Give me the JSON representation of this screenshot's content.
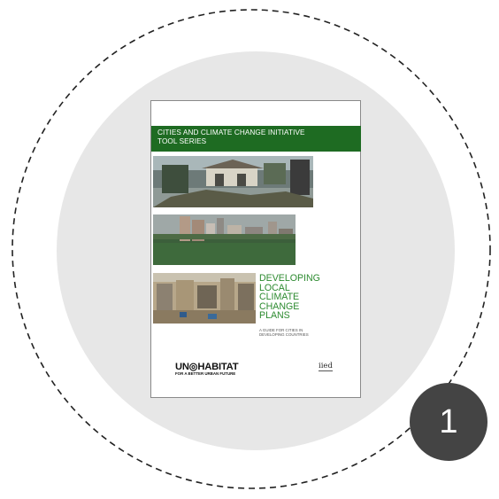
{
  "cover": {
    "series_line1": "CITIES AND CLIMATE CHANGE INITIATIVE",
    "series_line2": "TOOL SERIES",
    "title_line1": "DEVELOPING",
    "title_line2": "LOCAL",
    "title_line3": "CLIMATE",
    "title_line4": "CHANGE",
    "title_line5": "PLANS",
    "subtitle_line1": "A GUIDE FOR CITIES IN",
    "subtitle_line2": "DEVELOPING COUNTRIES",
    "logo_un": "UN◎HABITAT",
    "logo_un_tagline": "FOR A BETTER URBAN FUTURE",
    "logo_iied": "iied"
  },
  "step_badge": {
    "number": "1"
  },
  "colors": {
    "banner_green": "#1e6b22",
    "title_green": "#2c8a2f",
    "badge": "#444444",
    "disc": "#e7e7e7"
  }
}
